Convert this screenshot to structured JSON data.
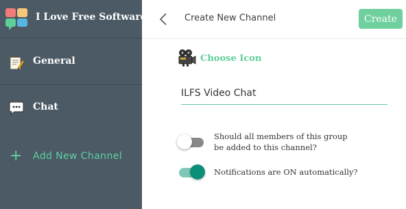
{
  "app": {
    "title": "I Love Free Software",
    "logo_icon": "chat-bubbles-logo-icon"
  },
  "sidebar": {
    "items": [
      {
        "label": "General",
        "icon": "notepad-icon"
      },
      {
        "label": "Chat",
        "icon": "speech-bubble-icon"
      }
    ],
    "add_channel": {
      "icon": "plus-icon",
      "label": "Add New Channel"
    }
  },
  "header": {
    "back_icon": "chevron-left-icon",
    "title": "Create New Channel",
    "create_label": "Create"
  },
  "form": {
    "choose_icon": {
      "icon": "film-camera-icon",
      "label": "Choose Icon"
    },
    "channel_name_value": "ILFS Video Chat",
    "options": [
      {
        "text_line1": "Should all members of this group",
        "text_line2": "be added to this channel?",
        "enabled": false
      },
      {
        "text": "Notifications are ON automatically?",
        "enabled": true
      }
    ]
  },
  "colors": {
    "sidebar_bg": "#4b5a65",
    "accent_green": "#5fd0a0",
    "create_button": "#6fcf9d",
    "toggle_on": "#0b8f78"
  }
}
